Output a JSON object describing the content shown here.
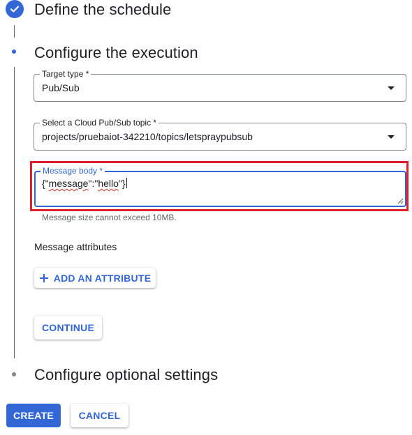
{
  "steps": {
    "define": {
      "title": "Define the schedule",
      "status": "completed"
    },
    "configure": {
      "title": "Configure the execution",
      "status": "active"
    },
    "optional": {
      "title": "Configure optional settings",
      "status": "pending"
    }
  },
  "form": {
    "target_type": {
      "label": "Target type *",
      "value": "Pub/Sub"
    },
    "topic": {
      "label": "Select a Cloud Pub/Sub topic *",
      "value": "projects/pruebaiot-342210/topics/letspraypubsub"
    },
    "message_body": {
      "label": "Message body *",
      "value_parts": [
        "{\"",
        "message",
        "\":\"",
        "hello",
        "\"}"
      ],
      "hint": "Message size cannot exceed 10MB."
    },
    "message_attributes": {
      "label": "Message attributes",
      "add_button": "ADD AN ATTRIBUTE"
    },
    "continue_button": "CONTINUE"
  },
  "footer": {
    "create_button": "CREATE",
    "cancel_button": "CANCEL"
  },
  "colors": {
    "accent": "#3367d6",
    "highlight": "#e0202a",
    "text": "#202124",
    "muted": "#5f6368"
  }
}
